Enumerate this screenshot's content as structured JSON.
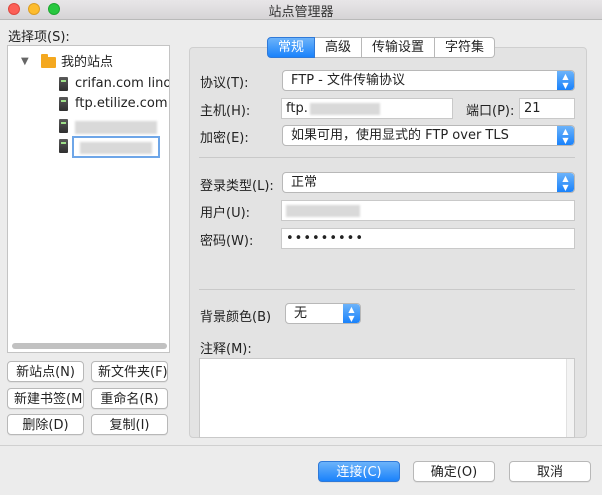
{
  "window": {
    "title": "站点管理器"
  },
  "left": {
    "select_label": "选择项(S):",
    "tree": {
      "root_label": "我的站点",
      "sites": [
        "crifan.com linode",
        "ftp.etilize.com"
      ]
    },
    "buttons": {
      "new_site": "新站点(N)",
      "new_folder": "新文件夹(F)",
      "new_bookmark": "新建书签(M)",
      "rename": "重命名(R)",
      "delete": "删除(D)",
      "copy": "复制(I)"
    }
  },
  "tabs": [
    "常规",
    "高级",
    "传输设置",
    "字符集"
  ],
  "general": {
    "protocol_label": "协议(T):",
    "protocol_value": "FTP - 文件传输协议",
    "host_label": "主机(H):",
    "host_value": "ftp.",
    "port_label": "端口(P):",
    "port_value": "21",
    "encryption_label": "加密(E):",
    "encryption_value": "如果可用，使用显式的 FTP over TLS",
    "logon_type_label": "登录类型(L):",
    "logon_type_value": "正常",
    "user_label": "用户(U):",
    "password_label": "密码(W):",
    "password_value": "•••••••••",
    "bg_color_label": "背景颜色(B)",
    "bg_color_value": "无",
    "comments_label": "注释(M):"
  },
  "footer": {
    "connect": "连接(C)",
    "ok": "确定(O)",
    "cancel": "取消"
  },
  "colors": {
    "accent": "#1a82fb",
    "folder": "#f4a81f",
    "selection": "#6ea6e8"
  }
}
